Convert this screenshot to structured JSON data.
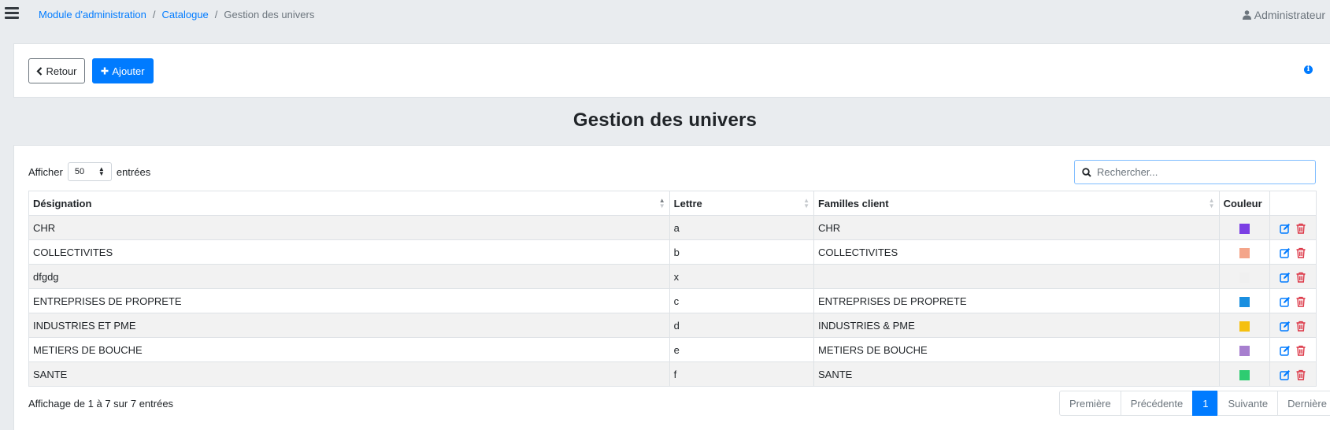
{
  "breadcrumb": {
    "item1": "Module d'administration",
    "item2": "Catalogue",
    "current": "Gestion des univers",
    "separator": "/"
  },
  "user": {
    "name": "Administrateur",
    "icon": "user-icon"
  },
  "actions": {
    "back_label": "Retour",
    "add_label": "Ajouter"
  },
  "page_title": "Gestion des univers",
  "length": {
    "prefix": "Afficher",
    "value": "50",
    "suffix": "entrées"
  },
  "search": {
    "placeholder": "Rechercher..."
  },
  "table": {
    "headers": {
      "designation": "Désignation",
      "lettre": "Lettre",
      "familles": "Familles client",
      "couleur": "Couleur"
    },
    "rows": [
      {
        "designation": "CHR",
        "lettre": "a",
        "familles": "CHR",
        "color": "#7b3fe4"
      },
      {
        "designation": "COLLECTIVITES",
        "lettre": "b",
        "familles": "COLLECTIVITES",
        "color": "#f4a58a"
      },
      {
        "designation": "dfgdg",
        "lettre": "x",
        "familles": "",
        "color": "#f0f0f0"
      },
      {
        "designation": "ENTREPRISES DE PROPRETE",
        "lettre": "c",
        "familles": "ENTREPRISES DE PROPRETE",
        "color": "#1a8fe0"
      },
      {
        "designation": "INDUSTRIES ET PME",
        "lettre": "d",
        "familles": "INDUSTRIES & PME",
        "color": "#f5c010"
      },
      {
        "designation": "METIERS DE BOUCHE",
        "lettre": "e",
        "familles": "METIERS DE BOUCHE",
        "color": "#a77fcf"
      },
      {
        "designation": "SANTE",
        "lettre": "f",
        "familles": "SANTE",
        "color": "#2ecc71"
      }
    ]
  },
  "info_text": "Affichage de 1 à 7 sur 7 entrées",
  "pagination": {
    "first": "Première",
    "prev": "Précédente",
    "page": "1",
    "next": "Suivante",
    "last": "Dernière"
  },
  "colors": {
    "primary": "#007bff",
    "danger": "#dc3545"
  }
}
